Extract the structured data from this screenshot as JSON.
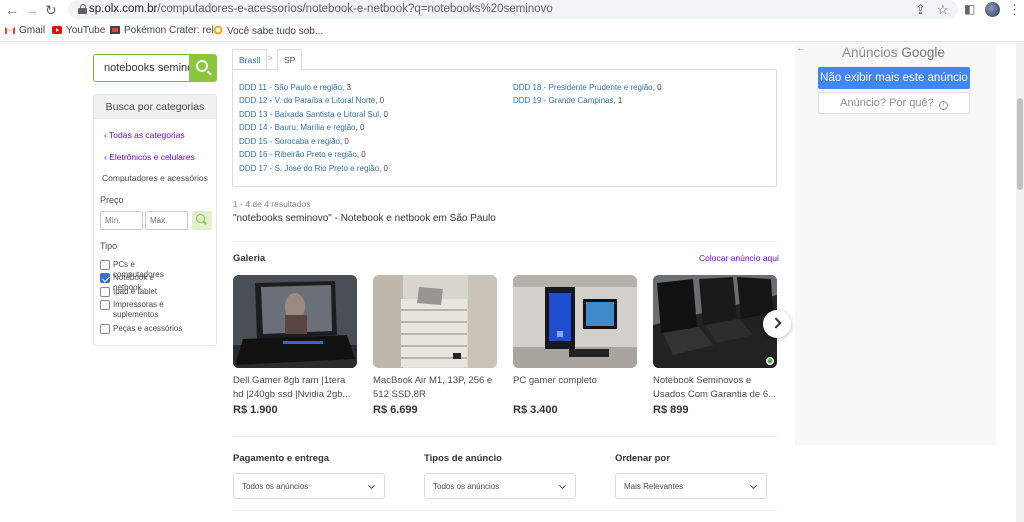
{
  "browser": {
    "url_host": "sp.olx.com.br",
    "url_path": "/computadores-e-acessorios/notebook-e-netbook?q=notebooks%20seminovo",
    "bookmarks": [
      {
        "label": "Gmail",
        "icon": "gmail-icon"
      },
      {
        "label": "YouTube",
        "icon": "youtube-icon"
      },
      {
        "label": "Pokémon Crater: rel...",
        "icon": "pokemon-icon"
      },
      {
        "label": "Você sabe tudo sob...",
        "icon": "quiz-icon"
      }
    ]
  },
  "search": {
    "value": "notebooks seminov"
  },
  "sidebar": {
    "heading": "Busca por categorias",
    "all_categories": "Todas as categorias",
    "parent_category": "Eletrônicos e celulares",
    "current_category": "Computadores e acessórios",
    "price_label": "Preço",
    "price_min_placeholder": "Mín.",
    "price_max_placeholder": "Máx.",
    "type_label": "Tipo",
    "types": [
      {
        "label": "PCs e computadores",
        "checked": false
      },
      {
        "label": "Notebook e netbook",
        "checked": true
      },
      {
        "label": "Ipad e tablet",
        "checked": false
      },
      {
        "label": "Impressoras e suplementos",
        "checked": false
      },
      {
        "label": "Peças e acessórios",
        "checked": false
      }
    ]
  },
  "breadcrumb": {
    "country": "Brasil",
    "separator": ">",
    "state": "SP"
  },
  "regions": [
    {
      "name": "DDD 11 - São Paulo e região",
      "count": ", 3"
    },
    {
      "name": "DDD 12 - V. do Paraíba e Litoral Norte",
      "count": ", 0"
    },
    {
      "name": "DDD 13 - Baixada Santista e Litoral Sul",
      "count": ", 0"
    },
    {
      "name": "DDD 14 - Bauru, Marília e região",
      "count": ", 0"
    },
    {
      "name": "DDD 15 - Sorocaba e região",
      "count": ", 0"
    },
    {
      "name": "DDD 16 - Ribeirão Preto e região",
      "count": ", 0"
    },
    {
      "name": "DDD 17 - S. José do Rio Preto e região",
      "count": ", 0"
    },
    {
      "name": "DDD 18 - Presidente Prudente e região",
      "count": ", 0"
    },
    {
      "name": "DDD 19 - Grande Campinas",
      "count": ", 1"
    }
  ],
  "results": {
    "count": "1 - 4 de 4 resultados",
    "title": "\"notebooks seminovo\" - Notebook e netbook em São Paulo"
  },
  "gallery": {
    "title": "Galeria",
    "place_ad": "Colocar anúncio aqui",
    "items": [
      {
        "title": "Dell Gamer 8gb ram |1tera hd |240gb ssd |Nvidia 2gb...",
        "price": "R$ 1.900"
      },
      {
        "title": "MacBook Air M1, 13P, 256 e 512 SSD,8R",
        "price": "R$ 6.699"
      },
      {
        "title": "PC gamer completo",
        "price": "R$ 3.400"
      },
      {
        "title": "Notebook Seminovos e Usados Com Garantia de 6...",
        "price": "R$ 899"
      }
    ]
  },
  "filters": [
    {
      "label": "Pagamento e entrega",
      "value": "Todos os anúncios"
    },
    {
      "label": "Tipos de anúncio",
      "value": "Todos os anúncios"
    },
    {
      "label": "Ordenar por",
      "value": "Mais Relevantes"
    }
  ],
  "ad": {
    "heading_prefix": "Anúncios",
    "heading_brand": "Google",
    "stop_button": "Não exibir mais este anúncio",
    "why_button": "Anúncio? Por quê?"
  },
  "colors": {
    "accent_green": "#8cc63f",
    "link_purple": "#6e0ad6",
    "region_blue": "#3471a8",
    "google_blue": "#4285f4"
  }
}
